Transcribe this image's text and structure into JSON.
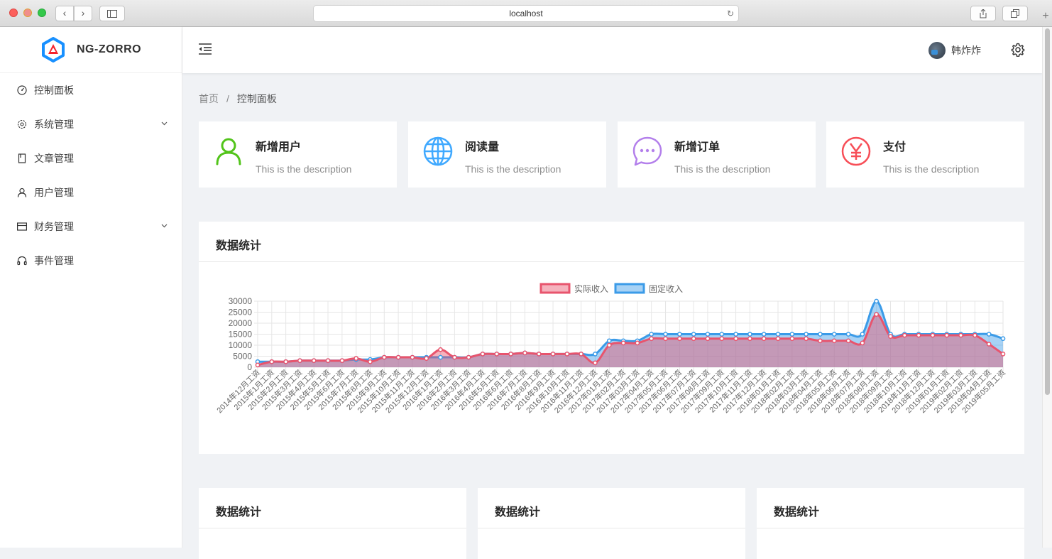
{
  "browser": {
    "url": "localhost"
  },
  "app": {
    "name": "NG-ZORRO"
  },
  "sidebar": {
    "items": [
      {
        "label": "控制面板",
        "icon": "dashboard-icon",
        "has_children": false
      },
      {
        "label": "系统管理",
        "icon": "setting-icon",
        "has_children": true
      },
      {
        "label": "文章管理",
        "icon": "book-icon",
        "has_children": false
      },
      {
        "label": "用户管理",
        "icon": "user-icon",
        "has_children": false
      },
      {
        "label": "财务管理",
        "icon": "credit-card-icon",
        "has_children": true
      },
      {
        "label": "事件管理",
        "icon": "headphones-icon",
        "has_children": false
      }
    ]
  },
  "header": {
    "username": "韩炸炸"
  },
  "breadcrumb": {
    "home": "首页",
    "separator": "/",
    "current": "控制面板"
  },
  "stats": [
    {
      "title": "新增用户",
      "desc": "This is the description",
      "icon": "user-icon",
      "color": "#52c41a"
    },
    {
      "title": "阅读量",
      "desc": "This is the description",
      "icon": "global-icon",
      "color": "#1890ff"
    },
    {
      "title": "新增订单",
      "desc": "This is the description",
      "icon": "message-icon",
      "color": "#b37feb"
    },
    {
      "title": "支付",
      "desc": "This is the description",
      "icon": "yen-icon",
      "color": "#f5222d"
    }
  ],
  "main_card": {
    "title": "数据统计"
  },
  "bottom_cards": [
    {
      "title": "数据统计"
    },
    {
      "title": "数据统计"
    },
    {
      "title": "数据统计"
    }
  ],
  "chart_data": {
    "type": "area",
    "title": "",
    "xlabel": "",
    "ylabel": "",
    "ylim": [
      0,
      30000
    ],
    "yticks": [
      0,
      5000,
      10000,
      15000,
      20000,
      25000,
      30000
    ],
    "grid": true,
    "legend_position": "top-center",
    "x": [
      "2014年12月工资",
      "2015年1月工资",
      "2015年2月工资",
      "2015年3月工资",
      "2015年4月工资",
      "2015年5月工资",
      "2015年6月工资",
      "2015年7月工资",
      "2015年8月工资",
      "2015年9月工资",
      "2015年10月工资",
      "2015年11月工资",
      "2015年12月工资",
      "2016年1月工资",
      "2016年2月工资",
      "2016年3月工资",
      "2016年4月工资",
      "2016年5月工资",
      "2016年6月工资",
      "2016年7月工资",
      "2016年8月工资",
      "2016年9月工资",
      "2016年10月工资",
      "2016年11月工资",
      "2016年12月工资",
      "2017年01月工资",
      "2017年02月工资",
      "2017年03月工资",
      "2017年04月工资",
      "2017年05月工资",
      "2017年06月工资",
      "2017年07月工资",
      "2017年08月工资",
      "2017年09月工资",
      "2017年10月工资",
      "2017年11月工资",
      "2017年12月工资",
      "2018年01月工资",
      "2018年02月工资",
      "2018年03月工资",
      "2018年04月工资",
      "2018年05月工资",
      "2018年06月工资",
      "2018年07月工资",
      "2018年08月工资",
      "2018年09月工资",
      "2018年10月工资",
      "2018年11月工资",
      "2018年12月工资",
      "2019年01月工资",
      "2019年02月工资",
      "2019年03月工资",
      "2019年04月工资",
      "2019年05月工资"
    ],
    "series": [
      {
        "name": "实际收入",
        "color": "#e8546d",
        "fill": "rgba(232,84,109,0.45)",
        "values": [
          1000,
          2500,
          2500,
          3000,
          3000,
          3000,
          3000,
          4000,
          2500,
          4500,
          4500,
          4500,
          4000,
          8000,
          4500,
          4500,
          6000,
          6000,
          6000,
          6500,
          6000,
          6000,
          6000,
          6000,
          2000,
          10000,
          11000,
          11000,
          13000,
          13000,
          13000,
          13000,
          13000,
          13000,
          13000,
          13000,
          13000,
          13000,
          13000,
          13000,
          12000,
          12000,
          12000,
          11000,
          24000,
          14000,
          14500,
          14500,
          14500,
          14500,
          14500,
          14500,
          10500,
          6000
        ]
      },
      {
        "name": "固定收入",
        "color": "#3b9be8",
        "fill": "rgba(59,155,232,0.45)",
        "values": [
          2500,
          2500,
          2500,
          3000,
          3000,
          3000,
          3000,
          3500,
          3500,
          4500,
          4500,
          4500,
          4500,
          4500,
          4500,
          4500,
          6000,
          6000,
          6000,
          6500,
          6000,
          6000,
          6000,
          6000,
          6000,
          12000,
          12000,
          12000,
          15000,
          15000,
          15000,
          15000,
          15000,
          15000,
          15000,
          15000,
          15000,
          15000,
          15000,
          15000,
          15000,
          15000,
          15000,
          15000,
          30000,
          15000,
          15000,
          15000,
          15000,
          15000,
          15000,
          15000,
          15000,
          13000
        ]
      }
    ]
  }
}
